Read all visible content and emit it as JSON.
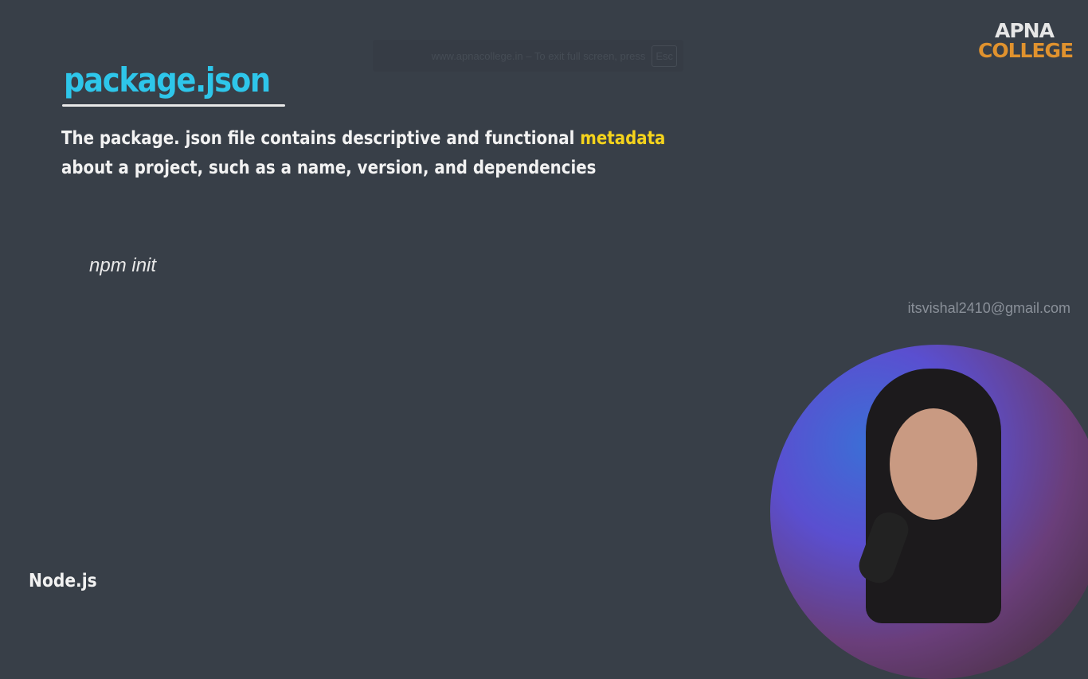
{
  "fullscreen_notice": {
    "text": "www.apnacollege.in – To exit full screen, press",
    "key": "Esc"
  },
  "logo": {
    "line1": "APNA",
    "line2": "COLLEGE"
  },
  "slide": {
    "title": "package.json",
    "description_before": "The package. json file contains descriptive and functional ",
    "description_highlight": "metadata",
    "description_after": " about a project, such as a name, version, and dependencies",
    "command": "npm init"
  },
  "watermark_email": "itsvishal2410@gmail.com",
  "footer": "Node.js",
  "colors": {
    "background": "#383f48",
    "title": "#2ec6ea",
    "highlight": "#f5d31c",
    "logo_accent": "#e0922e"
  }
}
